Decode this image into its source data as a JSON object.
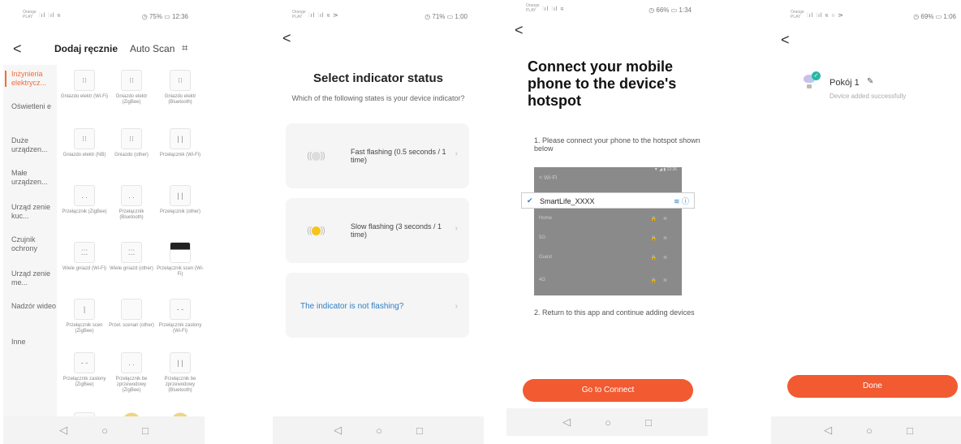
{
  "phones": {
    "p1": {
      "status": {
        "carrier": "Orange PLAY",
        "signal": "⫶ıl ⫶ıl ≋",
        "right": "◷ 75% ▭ 12:36"
      },
      "back": "<",
      "title": "Dodaj ręcznie",
      "auto_scan": "Auto Scan",
      "scan_icon": "⌗",
      "categories": [
        "Inżynieria elektrycz...",
        "Oświetleni e",
        "Duże urządzen...",
        "Małe urządzen...",
        "Urząd zenie kuc...",
        "Czujnik ochrony",
        "Urząd zenie me...",
        "Nadzór wideo",
        "Inne"
      ],
      "devices": [
        "Gniazdo elektr (Wi-Fi)",
        "Gniazdo elektr (ZigBee)",
        "Gniazdo elektr (Bluetooth)",
        "Gniazdo elektr (NB)",
        "Gniazdo (other)",
        "Przełącznik (Wi-Fi)",
        "Przełącznik (ZigBee)",
        "Przełącznik (Bluetooth)",
        "Przełącznik (other)",
        "Wiele gniazd (Wi-Fi)",
        "Wiele gniazd (other)",
        "Przełącznik scen (Wi-Fi)",
        "Przełącznik scen (ZigBee)",
        "Przeł. scenari (other)",
        "Przełącznik zasłony (Wi-Fi)",
        "Przełącznik zasłony (ZigBee)",
        "Przełącznik be zprzewodowy (ZigBee)",
        "Przełącznik be zprzewodowy (Bluetooth)",
        "",
        "",
        ""
      ]
    },
    "p2": {
      "status": {
        "carrier": "Orange PLAY",
        "signal": "⫶ıl ⫶ıl ≋ ⚞",
        "right": "◷ 71% ▭ 1:00"
      },
      "back": "<",
      "title": "Select indicator status",
      "subtitle": "Which of the following states is your device indicator?",
      "options": [
        {
          "label": "Fast flashing (0.5 seconds / 1 time)",
          "indicator_color": "#dddddd"
        },
        {
          "label": "Slow flashing (3 seconds / 1 time)",
          "indicator_color": "#f5c518"
        }
      ],
      "not_flashing": "The indicator is not flashing?"
    },
    "p3": {
      "status": {
        "carrier": "Orange PLAY",
        "signal": "⫶ıl ⫶ıl ≋",
        "right": "◷ 66% ▭ 1:34"
      },
      "back": "<",
      "title": "Connect your mobile phone to the device's hotspot",
      "step1": "1. Please connect your phone to the hotspot shown below",
      "wifi_header": "< Wi-Fi",
      "wifi_status": "▼ ◢ ▮ 12:36",
      "wifi_selected": "SmartLife_XXXX",
      "wifi_others": [
        "Home",
        "5G",
        "Guest",
        "4G"
      ],
      "step2": "2. Return to this app and continue adding devices",
      "connect_button": "Go to Connect"
    },
    "p4": {
      "status": {
        "carrier": "Orange PLAY",
        "signal": "⫶ıl ⫶ıl ≋ ○ ⚞",
        "right": "◷ 69% ▭ 1:06"
      },
      "back": "<",
      "device_name": "Pokój 1",
      "device_status": "Device added successfully",
      "done_button": "Done"
    }
  },
  "navbar": {
    "back": "◁",
    "home": "○",
    "recent": "□"
  },
  "colors": {
    "accent": "#f25a31",
    "link": "#2d7ec6",
    "active_category": "#f36b3a",
    "success": "#2bb7a6"
  }
}
